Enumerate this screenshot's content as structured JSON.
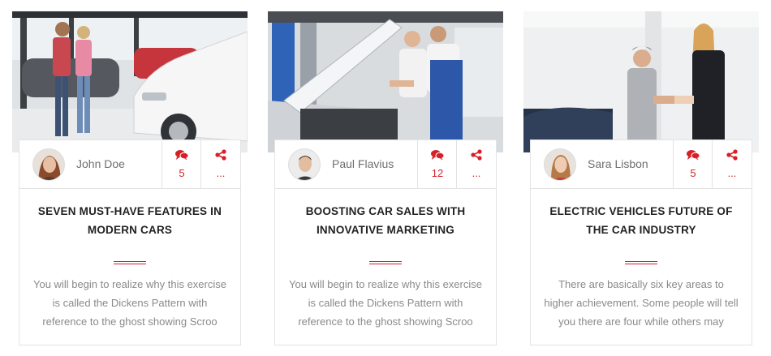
{
  "theme": {
    "accent": "#d81f26"
  },
  "cards": [
    {
      "image": "couple-at-car-showroom",
      "author": "John Doe",
      "comment_icon": "comments-icon",
      "comments": "5",
      "share_icon": "share-icon",
      "share": "...",
      "title": "SEVEN MUST-HAVE FEATURES IN MODERN CARS",
      "excerpt": "You will begin to realize why this exercise is called the Dickens Pattern with reference to the ghost showing Scroo"
    },
    {
      "image": "mechanics-inspecting-engine",
      "author": "Paul Flavius",
      "comment_icon": "comments-icon",
      "comments": "12",
      "share_icon": "share-icon",
      "share": "...",
      "title": "BOOSTING CAR SALES WITH INNOVATIVE MARKETING",
      "excerpt": "You will begin to realize why this exercise is called the Dickens Pattern with reference to the ghost showing Scroo"
    },
    {
      "image": "dealer-handshake",
      "author": "Sara Lisbon",
      "comment_icon": "comments-icon",
      "comments": "5",
      "share_icon": "share-icon",
      "share": "...",
      "title": "ELECTRIC VEHICLES FUTURE OF THE CAR INDUSTRY",
      "excerpt": "There are basically six key areas to higher achievement. Some people will tell you there are four while others may"
    }
  ]
}
